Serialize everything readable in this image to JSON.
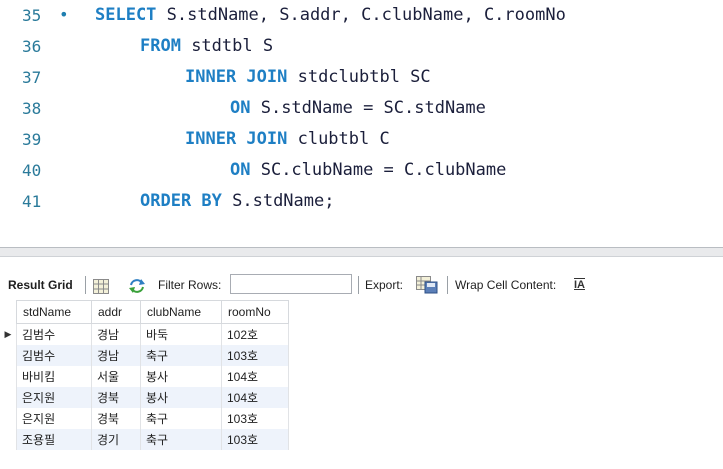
{
  "editor": {
    "lines": [
      {
        "no": "35",
        "marker": "•",
        "parts": [
          {
            "kw": "SELECT"
          },
          {
            "t": " S.stdName, S.addr, C.clubName, C.roomNo"
          }
        ]
      },
      {
        "no": "36",
        "parts": [
          {
            "kw": "FROM"
          },
          {
            "t": " stdtbl S"
          }
        ]
      },
      {
        "no": "37",
        "parts": [
          {
            "kw": "INNER JOIN"
          },
          {
            "t": " stdclubtbl SC"
          }
        ]
      },
      {
        "no": "38",
        "parts": [
          {
            "kw": "ON"
          },
          {
            "t": " S.stdName = SC.stdName"
          }
        ]
      },
      {
        "no": "39",
        "parts": [
          {
            "kw": "INNER JOIN"
          },
          {
            "t": " clubtbl C"
          }
        ]
      },
      {
        "no": "40",
        "parts": [
          {
            "kw": "ON"
          },
          {
            "t": " SC.clubName = C.clubName"
          }
        ]
      },
      {
        "no": "41",
        "parts": [
          {
            "kw": "ORDER BY"
          },
          {
            "t": " S.stdName;"
          }
        ]
      }
    ]
  },
  "toolbar": {
    "result_grid": "Result Grid",
    "filter_rows": "Filter Rows:",
    "filter_value": "",
    "export": "Export:",
    "wrap_cell": "Wrap Cell Content:",
    "wrap_icon_text": "IA"
  },
  "grid": {
    "columns": [
      "stdName",
      "addr",
      "clubName",
      "roomNo"
    ],
    "rows": [
      [
        "김범수",
        "경남",
        "바둑",
        "102호"
      ],
      [
        "김범수",
        "경남",
        "축구",
        "103호"
      ],
      [
        "바비킴",
        "서울",
        "봉사",
        "104호"
      ],
      [
        "은지원",
        "경북",
        "봉사",
        "104호"
      ],
      [
        "은지원",
        "경북",
        "축구",
        "103호"
      ],
      [
        "조용필",
        "경기",
        "축구",
        "103호"
      ]
    ],
    "current_row_marker": "▶"
  },
  "colors": {
    "keyword": "#1e7fc4",
    "line_number": "#2a7a9a",
    "alt_row": "#eef3fb"
  }
}
